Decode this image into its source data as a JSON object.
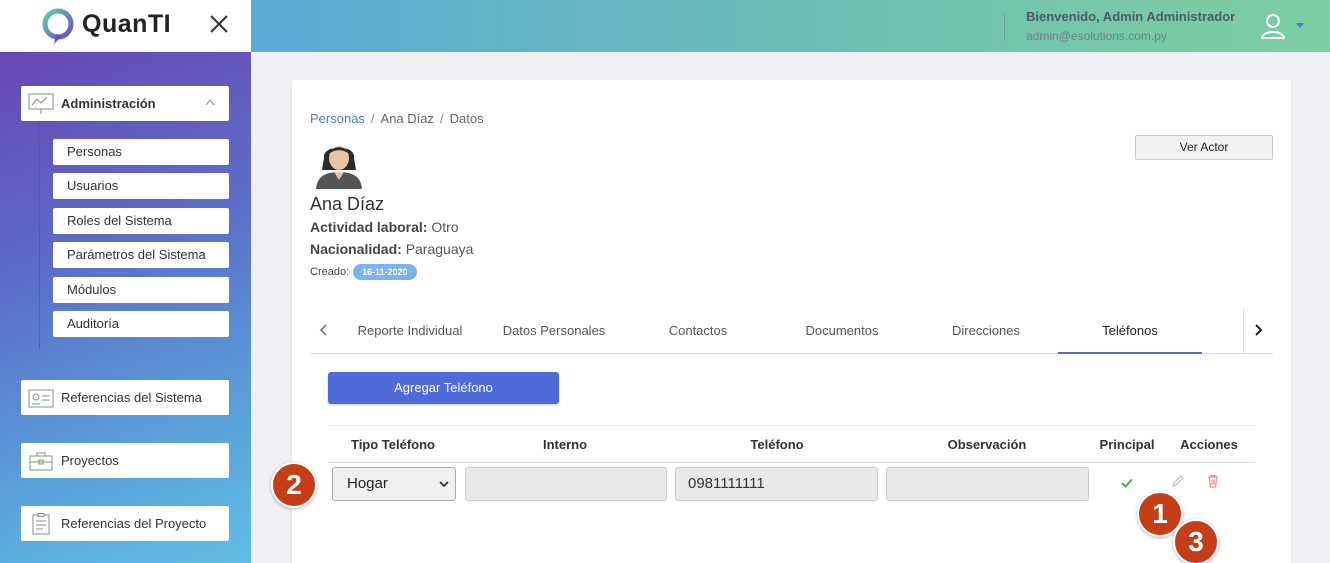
{
  "brand": {
    "name": "QuanTI"
  },
  "sidebar": {
    "admin_group": {
      "label": "Administración"
    },
    "admin_items": [
      {
        "label": "Personas"
      },
      {
        "label": "Usuarios"
      },
      {
        "label": "Roles del Sistema"
      },
      {
        "label": "Parámetros del Sistema"
      },
      {
        "label": "Módulos"
      },
      {
        "label": "Auditoría"
      }
    ],
    "groups": [
      {
        "label": "Referencias del Sistema"
      },
      {
        "label": "Proyectos"
      },
      {
        "label": "Referencias del Proyecto"
      }
    ]
  },
  "header": {
    "welcome": "Bienvenido, Admin Administrador",
    "email": "admin@esolutions.com.py"
  },
  "breadcrumb": {
    "root": "Personas",
    "person": "Ana Díaz",
    "current": "Datos",
    "sep": "/"
  },
  "profile": {
    "name": "Ana Díaz",
    "job_label": "Actividad laboral:",
    "job_value": "Otro",
    "nationality_label": "Nacionalidad:",
    "nationality_value": "Paraguaya",
    "created_label": "Creado:",
    "created_date": "16-11-2020",
    "ver_actor": "Ver Actor"
  },
  "tabs": [
    {
      "label": "Reporte Individual"
    },
    {
      "label": "Datos Personales"
    },
    {
      "label": "Contactos"
    },
    {
      "label": "Documentos"
    },
    {
      "label": "Direcciones"
    },
    {
      "label": "Teléfonos"
    }
  ],
  "active_tab": "Teléfonos",
  "add_button": "Agregar Teléfono",
  "table": {
    "headers": [
      "Tipo Teléfono",
      "Interno",
      "Teléfono",
      "Observación",
      "Principal",
      "Acciones"
    ],
    "rows": [
      {
        "tipo": "Hogar",
        "interno": "",
        "telefono": "0981111111",
        "observacion": "",
        "principal": true
      }
    ]
  },
  "markers": [
    "1",
    "2",
    "3"
  ],
  "colors": {
    "accent": "#4e6bd8",
    "marker": "#c43e17",
    "badge": "#7ab3ef",
    "check": "#4caf50",
    "delete": "#e57373"
  }
}
